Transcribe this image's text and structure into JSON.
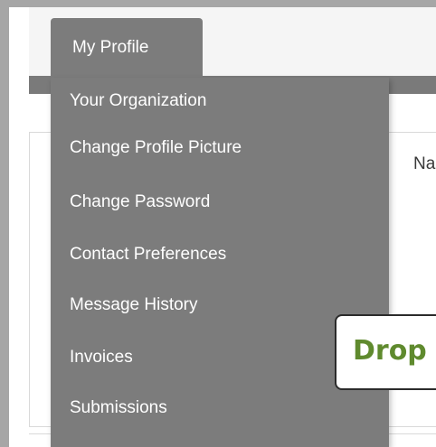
{
  "navbar": {
    "tab_label": "My Profile"
  },
  "dropdown": {
    "items": [
      "Your Organization",
      "Change Profile Picture",
      "Change Password",
      "Contact Preferences",
      "Message History",
      "Invoices",
      "Submissions"
    ]
  },
  "content": {
    "name_label_partial": "Na"
  },
  "callout": {
    "text": "Drop"
  },
  "colors": {
    "frame": "#a6a6a6",
    "menu_background": "#7c7c7c",
    "menu_text": "#ffffff",
    "callout_text": "#5f8a2e",
    "callout_border": "#2b2b2b"
  }
}
